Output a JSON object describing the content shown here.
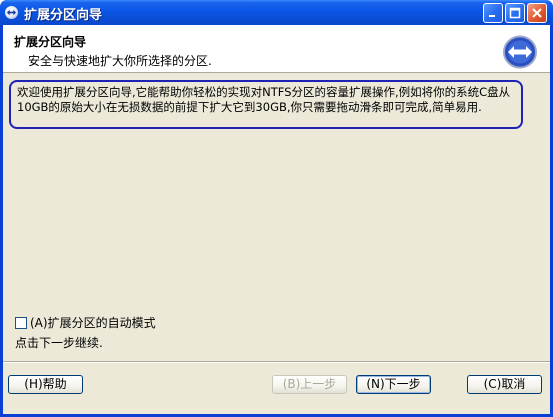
{
  "window": {
    "title": "扩展分区向导"
  },
  "header": {
    "title": "扩展分区向导",
    "subtitle": "安全与快速地扩大你所选择的分区."
  },
  "description": "欢迎使用扩展分区向导,它能帮助你轻松的实现对NTFS分区的容量扩展操作,例如将你的系统C盘从10GB的原始大小在无损数据的前提下扩大它到30GB,你只需要拖动滑条即可完成,简单易用.",
  "options": {
    "auto_mode_label": "(A)扩展分区的自动模式",
    "auto_mode_checked": false
  },
  "hint": "点击下一步继续.",
  "buttons": {
    "help": "(H)帮助",
    "back": "(B)上一步",
    "next": "(N)下一步",
    "cancel": "(C)取消"
  },
  "colors": {
    "titlebar": "#0a55e6",
    "dialog_bg": "#ece9d8",
    "highlight_border": "#1f23b5",
    "disabled_text": "#aca899"
  }
}
